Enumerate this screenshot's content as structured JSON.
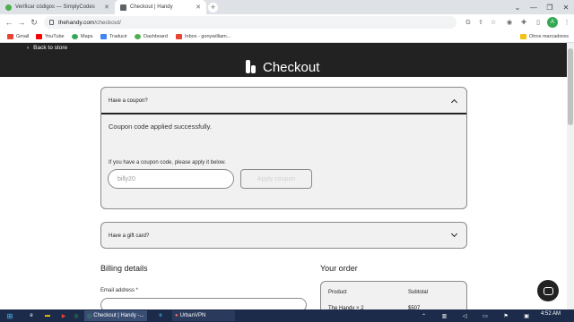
{
  "browser": {
    "tabs": [
      {
        "title": "Verificar códigos — SimplyCodes",
        "active": false,
        "favicon_color": "#4caf50"
      },
      {
        "title": "Checkout | Handy",
        "active": true,
        "favicon_color": "#5f6368"
      }
    ],
    "new_tab_glyph": "+",
    "window_controls": {
      "minimize": "—",
      "maximize": "❐",
      "close": "✕"
    },
    "nav": {
      "back": "←",
      "forward": "→",
      "reload": "↻"
    },
    "url_domain": "thehandy.com",
    "url_path": "/checkout/",
    "profile_initial": "A",
    "bookmarks": [
      {
        "label": "Gmail",
        "color": "#ea4335"
      },
      {
        "label": "YouTube",
        "color": "#ff0000"
      },
      {
        "label": "Maps",
        "color": "#34a853"
      },
      {
        "label": "Traducir",
        "color": "#4285f4"
      },
      {
        "label": "Dashboard",
        "color": "#4caf50"
      },
      {
        "label": "Inbox - gonywilliam...",
        "color": "#ea4335"
      }
    ],
    "other_bookmarks": "Otros marcadores"
  },
  "header": {
    "back_label": "Back to store",
    "title": "Checkout"
  },
  "coupon": {
    "heading": "Have a coupon?",
    "success_message": "Coupon code applied successfully.",
    "hint": "If you have a coupon code, please apply it below.",
    "input_value": "billy20",
    "apply_label": "Apply coupon"
  },
  "gift": {
    "heading": "Have a gift card?"
  },
  "billing": {
    "heading": "Billing details",
    "email_label": "Email address *"
  },
  "order": {
    "heading": "Your order",
    "col_product": "Product",
    "col_subtotal": "Subtotal",
    "first_item": "The Handy × 2",
    "first_subtotal": "$507"
  },
  "taskbar": {
    "items": [
      {
        "label": "Checkout | Handy -..."
      },
      {
        "label": "UrbanVPN"
      }
    ],
    "clock": "4:52 AM"
  }
}
